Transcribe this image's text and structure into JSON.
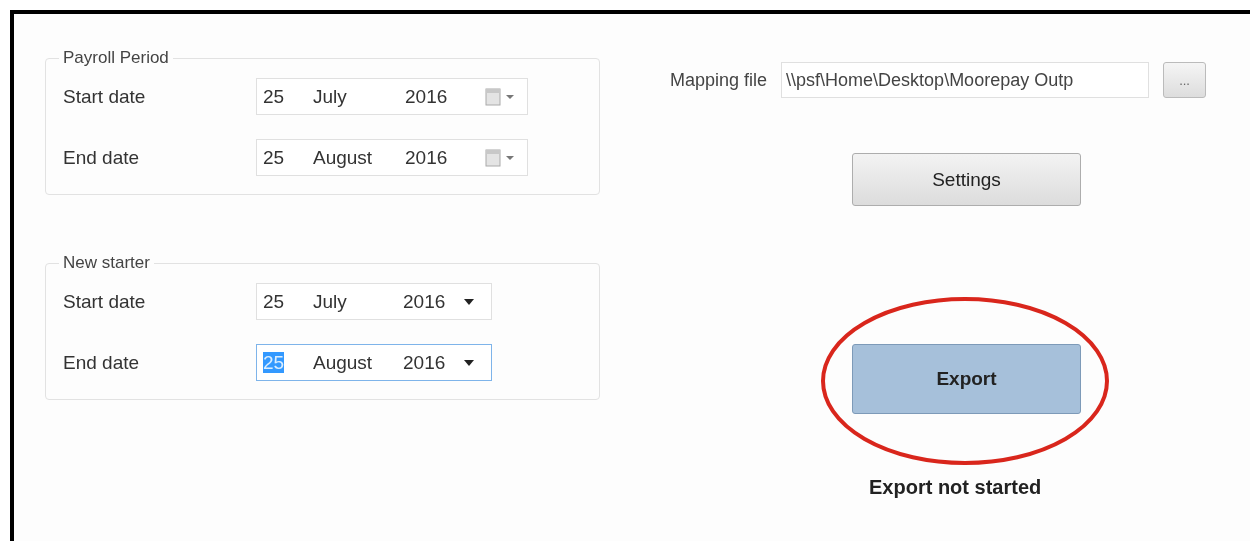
{
  "groups": [
    {
      "title": "Payroll Period",
      "fields": [
        {
          "label": "Start date",
          "kind": "calendar",
          "day": "25",
          "month": "July",
          "year": "2016",
          "day_selected": false
        },
        {
          "label": "End date",
          "kind": "calendar",
          "day": "25",
          "month": "August",
          "year": "2016",
          "day_selected": false
        }
      ]
    },
    {
      "title": "New starter",
      "fields": [
        {
          "label": "Start date",
          "kind": "dropdown",
          "day": "25",
          "month": "July",
          "year": "2016",
          "day_selected": false
        },
        {
          "label": "End date",
          "kind": "dropdown",
          "day": "25",
          "month": "August",
          "year": "2016",
          "day_selected": true
        }
      ]
    }
  ],
  "mapping_file": {
    "label": "Mapping file",
    "value": "\\\\psf\\Home\\Desktop\\Moorepay Outp",
    "browse": "..."
  },
  "buttons": [
    {
      "label": "Settings",
      "focused": false,
      "circled": false
    },
    {
      "label": "Export",
      "focused": true,
      "circled": true
    }
  ],
  "status": "Export not started"
}
